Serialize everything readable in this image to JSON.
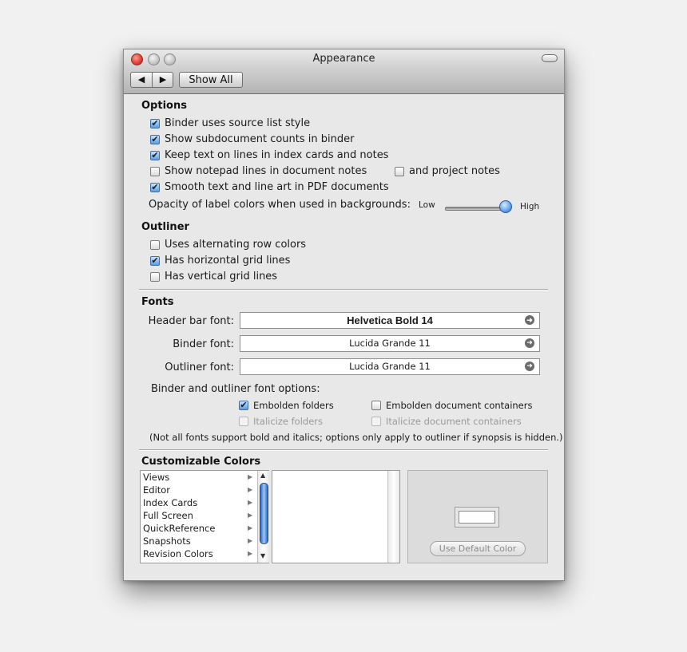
{
  "window": {
    "title": "Appearance",
    "show_all": "Show All",
    "back_glyph": "◀",
    "forward_glyph": "▶"
  },
  "options": {
    "heading": "Options",
    "items": [
      {
        "label": "Binder uses source list style",
        "checked": true
      },
      {
        "label": "Show subdocument counts in binder",
        "checked": true
      },
      {
        "label": "Keep text on lines in index cards and notes",
        "checked": true
      },
      {
        "label": "Show notepad lines in document notes",
        "checked": false
      },
      {
        "label": "and project notes",
        "checked": false
      },
      {
        "label": "Smooth text and line art in PDF documents",
        "checked": true
      }
    ],
    "opacity_label": "Opacity of label colors when used in backgrounds:",
    "slider_low": "Low",
    "slider_high": "High",
    "slider_value_fraction": 1.0
  },
  "outliner": {
    "heading": "Outliner",
    "items": [
      {
        "label": "Uses alternating row colors",
        "checked": false
      },
      {
        "label": "Has horizontal grid lines",
        "checked": true
      },
      {
        "label": "Has vertical grid lines",
        "checked": false
      }
    ]
  },
  "fonts": {
    "heading": "Fonts",
    "header_label": "Header bar font:",
    "header_value": "Helvetica Bold 14",
    "binder_label": "Binder font:",
    "binder_value": "Lucida Grande 11",
    "outliner_label": "Outliner font:",
    "outliner_value": "Lucida Grande 11",
    "arrow_glyph": "➜",
    "options_label": "Binder and outliner font options:",
    "embolden_folders": "Embolden folders",
    "embolden_containers": "Embolden document containers",
    "italicize_folders": "Italicize folders",
    "italicize_containers": "Italicize document containers",
    "note": "(Not all fonts support bold and italics; options only apply to outliner if synopsis is hidden.)"
  },
  "colors": {
    "heading": "Customizable Colors",
    "list": [
      "Views",
      "Editor",
      "Index Cards",
      "Full Screen",
      "QuickReference",
      "Snapshots",
      "Revision Colors"
    ],
    "use_default": "Use Default Color",
    "swatch_color": "#ffffff"
  }
}
